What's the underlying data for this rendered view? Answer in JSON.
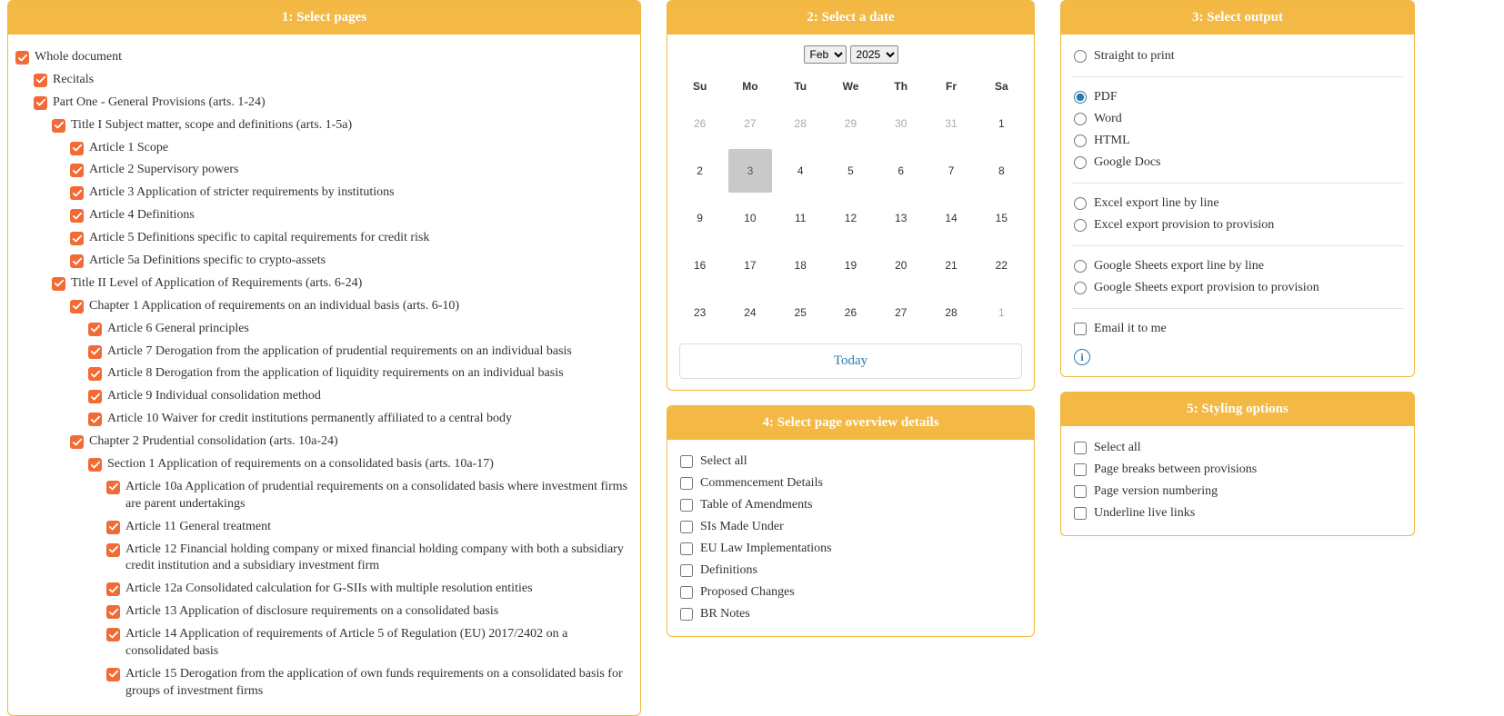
{
  "panels": {
    "pages": "1: Select pages",
    "date": "2: Select a date",
    "output": "3: Select output",
    "details": "4: Select page overview details",
    "styling": "5: Styling options"
  },
  "tree": {
    "whole": "Whole document",
    "recitals": "Recitals",
    "part1": "Part One - General Provisions (arts. 1-24)",
    "title1": "Title I Subject matter, scope and definitions (arts. 1-5a)",
    "a1": "Article 1 Scope",
    "a2": "Article 2 Supervisory powers",
    "a3": "Article 3 Application of stricter requirements by institutions",
    "a4": "Article 4 Definitions",
    "a5": "Article 5 Definitions specific to capital requirements for credit risk",
    "a5a": "Article 5a Definitions specific to crypto-assets",
    "title2": "Title II Level of Application of Requirements (arts. 6-24)",
    "ch1": "Chapter 1 Application of requirements on an individual basis (arts. 6-10)",
    "a6": "Article 6 General principles",
    "a7": "Article 7 Derogation from the application of prudential requirements on an individual basis",
    "a8": "Article 8 Derogation from the application of liquidity requirements on an individual basis",
    "a9": "Article 9 Individual consolidation method",
    "a10": "Article 10 Waiver for credit institutions permanently affiliated to a central body",
    "ch2": "Chapter 2 Prudential consolidation (arts. 10a-24)",
    "sec1": "Section 1 Application of requirements on a consolidated basis (arts. 10a-17)",
    "a10a": "Article 10a Application of prudential requirements on a consolidated basis where investment firms are parent undertakings",
    "a11": "Article 11 General treatment",
    "a12": "Article 12 Financial holding company or mixed financial holding company with both a subsidiary credit institution and a subsidiary investment firm",
    "a12a": "Article 12a Consolidated calculation for G-SIIs with multiple resolution entities",
    "a13": "Article 13 Application of disclosure requirements on a consolidated basis",
    "a14": "Article 14 Application of requirements of Article 5 of Regulation (EU) 2017/2402 on a consolidated basis",
    "a15": "Article 15 Derogation from the application of own funds requirements on a consolidated basis for groups of investment firms"
  },
  "calendar": {
    "month": "Feb",
    "year": "2025",
    "weekdays": [
      "Su",
      "Mo",
      "Tu",
      "We",
      "Th",
      "Fr",
      "Sa"
    ],
    "weeks": [
      [
        {
          "n": "26",
          "other": true
        },
        {
          "n": "27",
          "other": true
        },
        {
          "n": "28",
          "other": true
        },
        {
          "n": "29",
          "other": true
        },
        {
          "n": "30",
          "other": true
        },
        {
          "n": "31",
          "other": true
        },
        {
          "n": "1"
        }
      ],
      [
        {
          "n": "2"
        },
        {
          "n": "3",
          "sel": true
        },
        {
          "n": "4"
        },
        {
          "n": "5"
        },
        {
          "n": "6"
        },
        {
          "n": "7"
        },
        {
          "n": "8"
        }
      ],
      [
        {
          "n": "9"
        },
        {
          "n": "10"
        },
        {
          "n": "11"
        },
        {
          "n": "12"
        },
        {
          "n": "13"
        },
        {
          "n": "14"
        },
        {
          "n": "15"
        }
      ],
      [
        {
          "n": "16"
        },
        {
          "n": "17"
        },
        {
          "n": "18"
        },
        {
          "n": "19"
        },
        {
          "n": "20"
        },
        {
          "n": "21"
        },
        {
          "n": "22"
        }
      ],
      [
        {
          "n": "23"
        },
        {
          "n": "24"
        },
        {
          "n": "25"
        },
        {
          "n": "26"
        },
        {
          "n": "27"
        },
        {
          "n": "28"
        },
        {
          "n": "1",
          "other": true
        }
      ]
    ],
    "today": "Today"
  },
  "output": {
    "print": "Straight to print",
    "pdf": "PDF",
    "word": "Word",
    "html": "HTML",
    "gdocs": "Google Docs",
    "excel_line": "Excel export line by line",
    "excel_prov": "Excel export provision to provision",
    "gsheets_line": "Google Sheets export line by line",
    "gsheets_prov": "Google Sheets export provision to provision",
    "email": "Email it to me",
    "selected": "pdf"
  },
  "details": {
    "all": "Select all",
    "commencement": "Commencement Details",
    "amendments": "Table of Amendments",
    "sis": "SIs Made Under",
    "eu": "EU Law Implementations",
    "defs": "Definitions",
    "proposed": "Proposed Changes",
    "br": "BR Notes"
  },
  "styling": {
    "all": "Select all",
    "breaks": "Page breaks between provisions",
    "version": "Page version numbering",
    "underline": "Underline live links"
  }
}
